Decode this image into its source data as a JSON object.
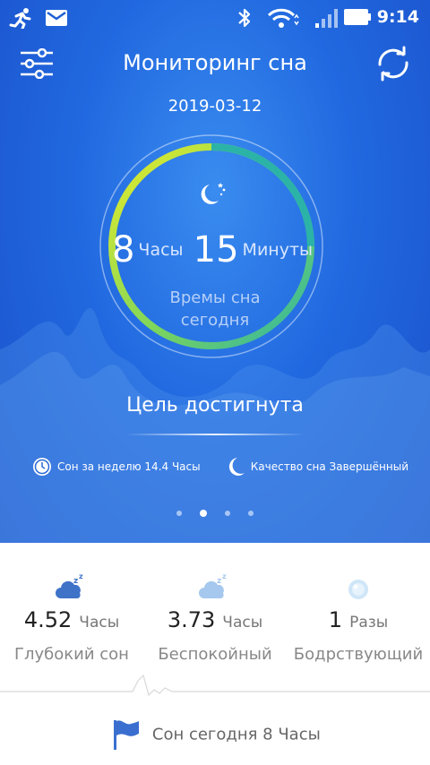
{
  "status_bar": {
    "time": "9:14",
    "icons": [
      "running-icon",
      "mail-icon",
      "bluetooth-icon",
      "wifi-icon",
      "signal-icon",
      "battery-icon"
    ]
  },
  "header": {
    "title": "Мониторинг сна",
    "menu_icon": "sliders-icon",
    "sync_icon": "sync-icon"
  },
  "date": "2019-03-12",
  "sleep_summary": {
    "hours": "8",
    "hours_unit": "Часы",
    "minutes": "15",
    "minutes_unit": "Минуты",
    "label_line1": "Времы сна",
    "label_line2": "сегодня",
    "ring_progress": 1.0,
    "ring_colors": [
      "#e8ec2a",
      "#7fd65a",
      "#2bb3a8"
    ]
  },
  "goal_text": "Цель достигнута",
  "info": {
    "week_text": "Сон за неделю 14.4 Часы",
    "quality_text": "Качество сна Завершённый"
  },
  "pager": {
    "count": 4,
    "active": 1
  },
  "stats": [
    {
      "value": "4.52",
      "unit": "Часы",
      "label": "Глубокий сон",
      "icon": "deep-sleep-cloud-icon",
      "color": "#3f73c8"
    },
    {
      "value": "3.73",
      "unit": "Часы",
      "label": "Беспокойный",
      "icon": "restless-sleep-cloud-icon",
      "color": "#a6c8ee"
    },
    {
      "value": "1",
      "unit": "Разы",
      "label": "Бодрствующий",
      "icon": "awake-icon",
      "color": "#cfe6f8"
    }
  ],
  "footer": {
    "text": "Сон сегодня 8 Часы",
    "icon": "flag-icon"
  },
  "colors": {
    "hero_top": "#3a8cf0",
    "hero_bottom": "#1a4fc9",
    "accent": "#2f6fd1"
  }
}
